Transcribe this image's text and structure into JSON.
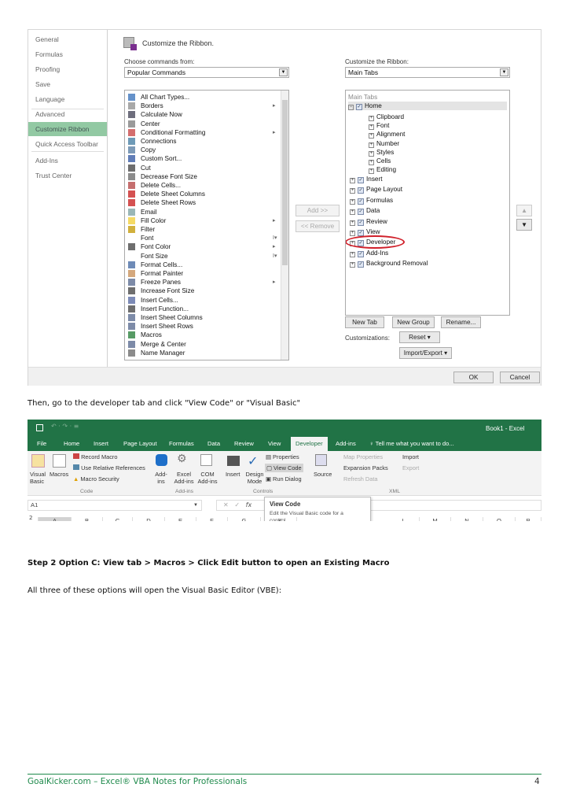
{
  "options_dialog": {
    "nav": [
      "General",
      "Formulas",
      "Proofing",
      "Save",
      "Language",
      "Advanced",
      "Customize Ribbon",
      "Quick Access Toolbar",
      "Add-Ins",
      "Trust Center"
    ],
    "selected_nav": "Customize Ribbon",
    "title": "Customize the Ribbon.",
    "choose_label": "Choose commands from:",
    "choose_value": "Popular Commands",
    "commands": [
      "All Chart Types...",
      "Borders",
      "Calculate Now",
      "Center",
      "Conditional Formatting",
      "Connections",
      "Copy",
      "Custom Sort...",
      "Cut",
      "Decrease Font Size",
      "Delete Cells...",
      "Delete Sheet Columns",
      "Delete Sheet Rows",
      "Email",
      "Fill Color",
      "Filter",
      "Font",
      "Font Color",
      "Font Size",
      "Format Cells...",
      "Format Painter",
      "Freeze Panes",
      "Increase Font Size",
      "Insert Cells...",
      "Insert Function...",
      "Insert Sheet Columns",
      "Insert Sheet Rows",
      "Macros",
      "Merge & Center",
      "Name Manager"
    ],
    "customize_label": "Customize the Ribbon:",
    "customize_value": "Main Tabs",
    "tree_header": "Main Tabs",
    "home": "Home",
    "home_groups": [
      "Clipboard",
      "Font",
      "Alignment",
      "Number",
      "Styles",
      "Cells",
      "Editing"
    ],
    "tabs": [
      "Insert",
      "Page Layout",
      "Formulas",
      "Data",
      "Review",
      "View",
      "Developer",
      "Add-Ins",
      "Background Removal"
    ],
    "highlighted_tab": "Developer",
    "highlight_color": "#d0202a",
    "add_button": "Add >>",
    "remove_button": "<< Remove",
    "new_tab": "New Tab",
    "new_group": "New Group",
    "rename": "Rename...",
    "customizations_label": "Customizations:",
    "reset": "Reset ▾",
    "import_export": "Import/Export ▾",
    "ok": "OK",
    "cancel": "Cancel"
  },
  "text1": "Then, go to the developer tab and click \"View Code\" or \"Visual Basic\"",
  "excel": {
    "title": "Book1 - Excel",
    "accent": "#217346",
    "tabs": [
      "File",
      "Home",
      "Insert",
      "Page Layout",
      "Formulas",
      "Data",
      "Review",
      "View",
      "Developer",
      "Add-ins"
    ],
    "active_tab": "Developer",
    "tell_me": "Tell me what you want to do...",
    "code": {
      "visual_basic": "Visual Basic",
      "macros": "Macros",
      "record": "Record Macro",
      "relative": "Use Relative References",
      "security": "Macro Security",
      "label": "Code"
    },
    "addins": {
      "addins": "Add-ins",
      "excel": "Excel Add-ins",
      "com": "COM Add-ins",
      "label": "Add-ins"
    },
    "controls": {
      "insert": "Insert",
      "design": "Design Mode",
      "properties": "Properties",
      "view_code": "View Code",
      "run_dialog": "Run Dialog",
      "label": "Controls"
    },
    "xml": {
      "source": "Source",
      "map": "Map Properties",
      "expansion": "Expansion Packs",
      "refresh": "Refresh Data",
      "import": "Import",
      "export": "Export",
      "label": "XML"
    },
    "name_box": "A1",
    "fx": "fx",
    "tooltip_title": "View Code",
    "tooltip_text": "Edit the Visual Basic code for a control.",
    "columns": [
      "A",
      "B",
      "C",
      "D",
      "E",
      "F",
      "G",
      "K",
      "L",
      "M",
      "N",
      "O",
      "P"
    ],
    "rows": [
      "1",
      "2"
    ]
  },
  "heading": "Step 2 Option C: View tab > Macros > Click Edit button to open an Existing Macro",
  "text2": "All three of these options will open the Visual Basic Editor (VBE):",
  "footer": {
    "left": "GoalKicker.com – Excel® VBA Notes for Professionals",
    "page": "4"
  }
}
